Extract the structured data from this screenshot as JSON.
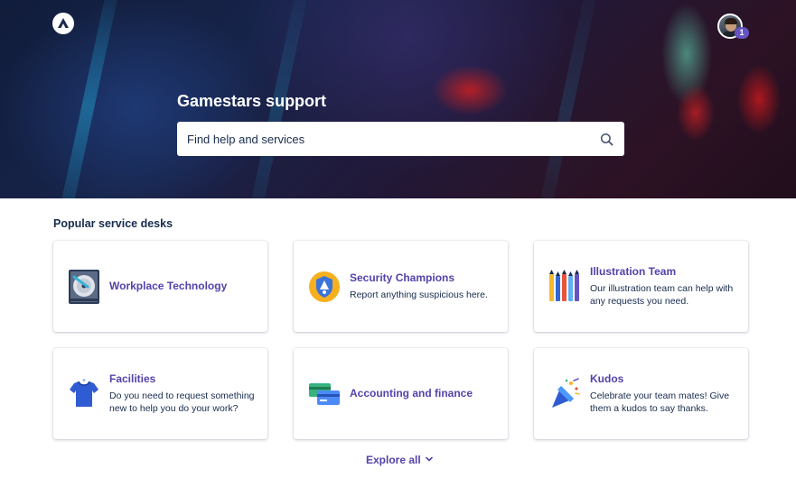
{
  "header": {
    "logo_icon": "atlassian-logo-icon",
    "avatar_badge_count": "1"
  },
  "hero": {
    "title": "Gamestars support",
    "search_placeholder": "Find help and services",
    "search_icon": "search-icon"
  },
  "popular": {
    "title": "Popular service desks",
    "desks": [
      {
        "name": "Workplace Technology",
        "description": "",
        "icon": "hard-drive-icon"
      },
      {
        "name": "Security Champions",
        "description": "Report anything suspicious here.",
        "icon": "security-badge-icon"
      },
      {
        "name": "Illustration Team",
        "description": "Our illustration team can help with any requests you need.",
        "icon": "pens-icon"
      },
      {
        "name": "Facilities",
        "description": "Do you need to request something new to help you do your work?",
        "icon": "tshirt-icon"
      },
      {
        "name": "Accounting and finance",
        "description": "",
        "icon": "credit-cards-icon"
      },
      {
        "name": "Kudos",
        "description": "Celebrate your team mates! Give them a kudos to say thanks.",
        "icon": "party-popper-icon"
      }
    ]
  },
  "footer": {
    "explore_label": "Explore all",
    "explore_icon": "chevron-down-icon"
  },
  "colors": {
    "accent": "#5243aa",
    "text": "#172b4d",
    "badge": "#6554c0"
  }
}
